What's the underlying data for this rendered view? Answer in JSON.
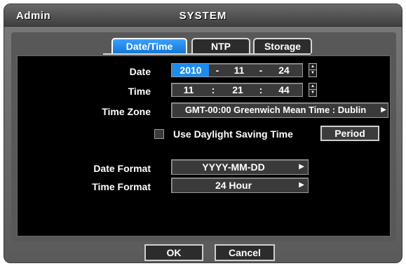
{
  "window": {
    "user": "Admin",
    "title": "SYSTEM"
  },
  "tabs": [
    {
      "label": "Date/Time",
      "active": true
    },
    {
      "label": "NTP",
      "active": false
    },
    {
      "label": "Storage",
      "active": false
    }
  ],
  "date": {
    "label": "Date",
    "year": "2010",
    "sep1": "-",
    "month": "11",
    "sep2": "-",
    "day": "24"
  },
  "time": {
    "label": "Time",
    "hour": "11",
    "sep1": ":",
    "minute": "21",
    "sep2": ":",
    "second": "44"
  },
  "timezone": {
    "label": "Time Zone",
    "value": "GMT-00:00 Greenwich Mean Time : Dublin"
  },
  "dst": {
    "label": "Use Daylight Saving Time",
    "checked": false,
    "period_button": "Period"
  },
  "date_format": {
    "label": "Date Format",
    "value": "YYYY-MM-DD"
  },
  "time_format": {
    "label": "Time Format",
    "value": "24 Hour"
  },
  "footer": {
    "ok": "OK",
    "cancel": "Cancel"
  },
  "colors": {
    "accent": "#1c8cf0",
    "background": "#000000",
    "chrome": "#5a5a5a"
  }
}
